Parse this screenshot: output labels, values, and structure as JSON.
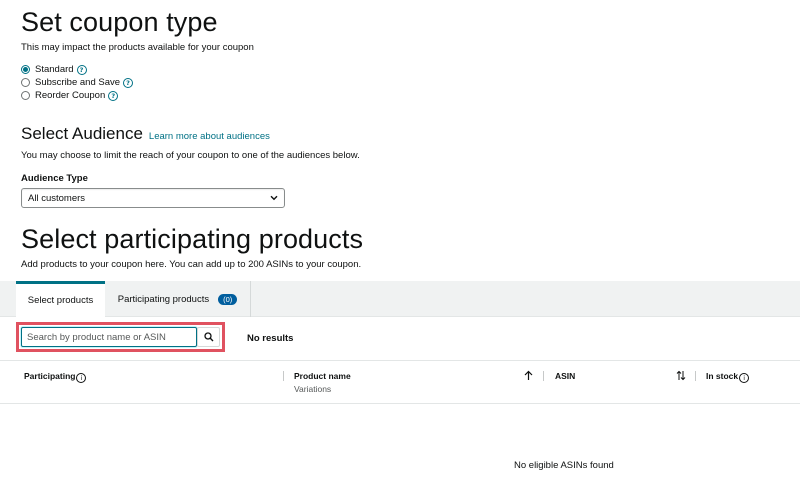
{
  "coupon_type": {
    "title": "Set coupon type",
    "subtitle": "This may impact the products available for your coupon",
    "options": [
      {
        "label": "Standard",
        "checked": true
      },
      {
        "label": "Subscribe and Save",
        "checked": false
      },
      {
        "label": "Reorder Coupon",
        "checked": false
      }
    ]
  },
  "audience": {
    "title": "Select Audience",
    "learn_more": "Learn more about audiences",
    "description": "You may choose to limit the reach of your coupon to one of the audiences below.",
    "type_label": "Audience Type",
    "selected": "All customers"
  },
  "products": {
    "title": "Select participating products",
    "subtitle": "Add products to your coupon here. You can add up to 200 ASINs to your coupon.",
    "tabs": [
      {
        "label": "Select products",
        "active": true
      },
      {
        "label": "Participating products",
        "count": "(0)",
        "active": false
      }
    ],
    "search_placeholder": "Search by product name or ASIN",
    "result_text": "No results",
    "columns": {
      "participating": "Participating",
      "product_name": "Product name",
      "variations": "Variations",
      "asin": "ASIN",
      "in_stock": "In stock"
    },
    "empty_text": "No eligible ASINs found"
  },
  "colors": {
    "accent": "#007185",
    "badge": "#005e9e",
    "highlight": "#e05260"
  }
}
